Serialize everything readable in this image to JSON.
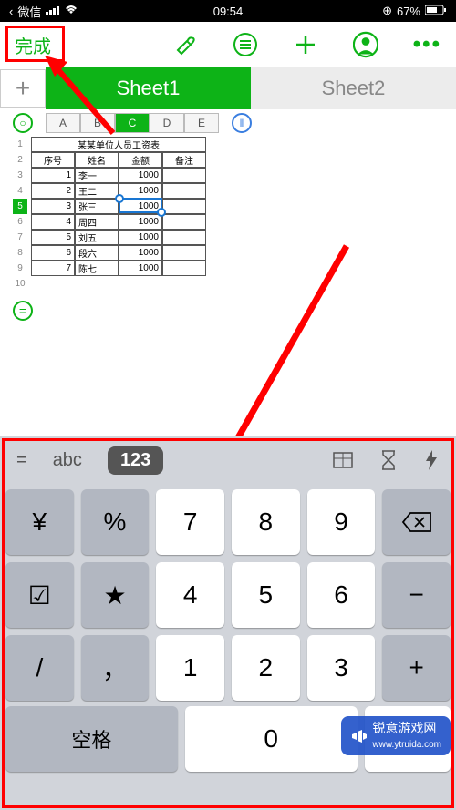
{
  "status": {
    "carrier": "微信",
    "time": "09:54",
    "battery": "67%"
  },
  "toolbar": {
    "done": "完成"
  },
  "tabs": {
    "add": "+",
    "active": "Sheet1",
    "inactive": "Sheet2"
  },
  "columns": [
    "A",
    "B",
    "C",
    "D",
    "E"
  ],
  "rows": [
    "1",
    "2",
    "3",
    "4",
    "5",
    "6",
    "7",
    "8",
    "9",
    "10"
  ],
  "table": {
    "title": "某某单位人员工资表",
    "headers": [
      "序号",
      "姓名",
      "金额",
      "备注"
    ],
    "data": [
      [
        "1",
        "李一",
        "1000",
        ""
      ],
      [
        "2",
        "王二",
        "1000",
        ""
      ],
      [
        "3",
        "张三",
        "1000",
        ""
      ],
      [
        "4",
        "周四",
        "1000",
        ""
      ],
      [
        "5",
        "刘五",
        "1000",
        ""
      ],
      [
        "6",
        "段六",
        "1000",
        ""
      ],
      [
        "7",
        "陈七",
        "1000",
        ""
      ]
    ]
  },
  "keyboard": {
    "top": {
      "eq": "=",
      "abc": "abc",
      "num": "123"
    },
    "keys": [
      [
        "¥",
        "%",
        "7",
        "8",
        "9",
        "⌫"
      ],
      [
        "☑",
        "★",
        "4",
        "5",
        "6",
        "−"
      ],
      [
        "/",
        "，",
        "1",
        "2",
        "3",
        "+"
      ]
    ],
    "bottom": {
      "space": "空格",
      "zero": "0",
      "dot": "."
    }
  },
  "watermark": "锐意游戏网\nwww.ytruida.com"
}
